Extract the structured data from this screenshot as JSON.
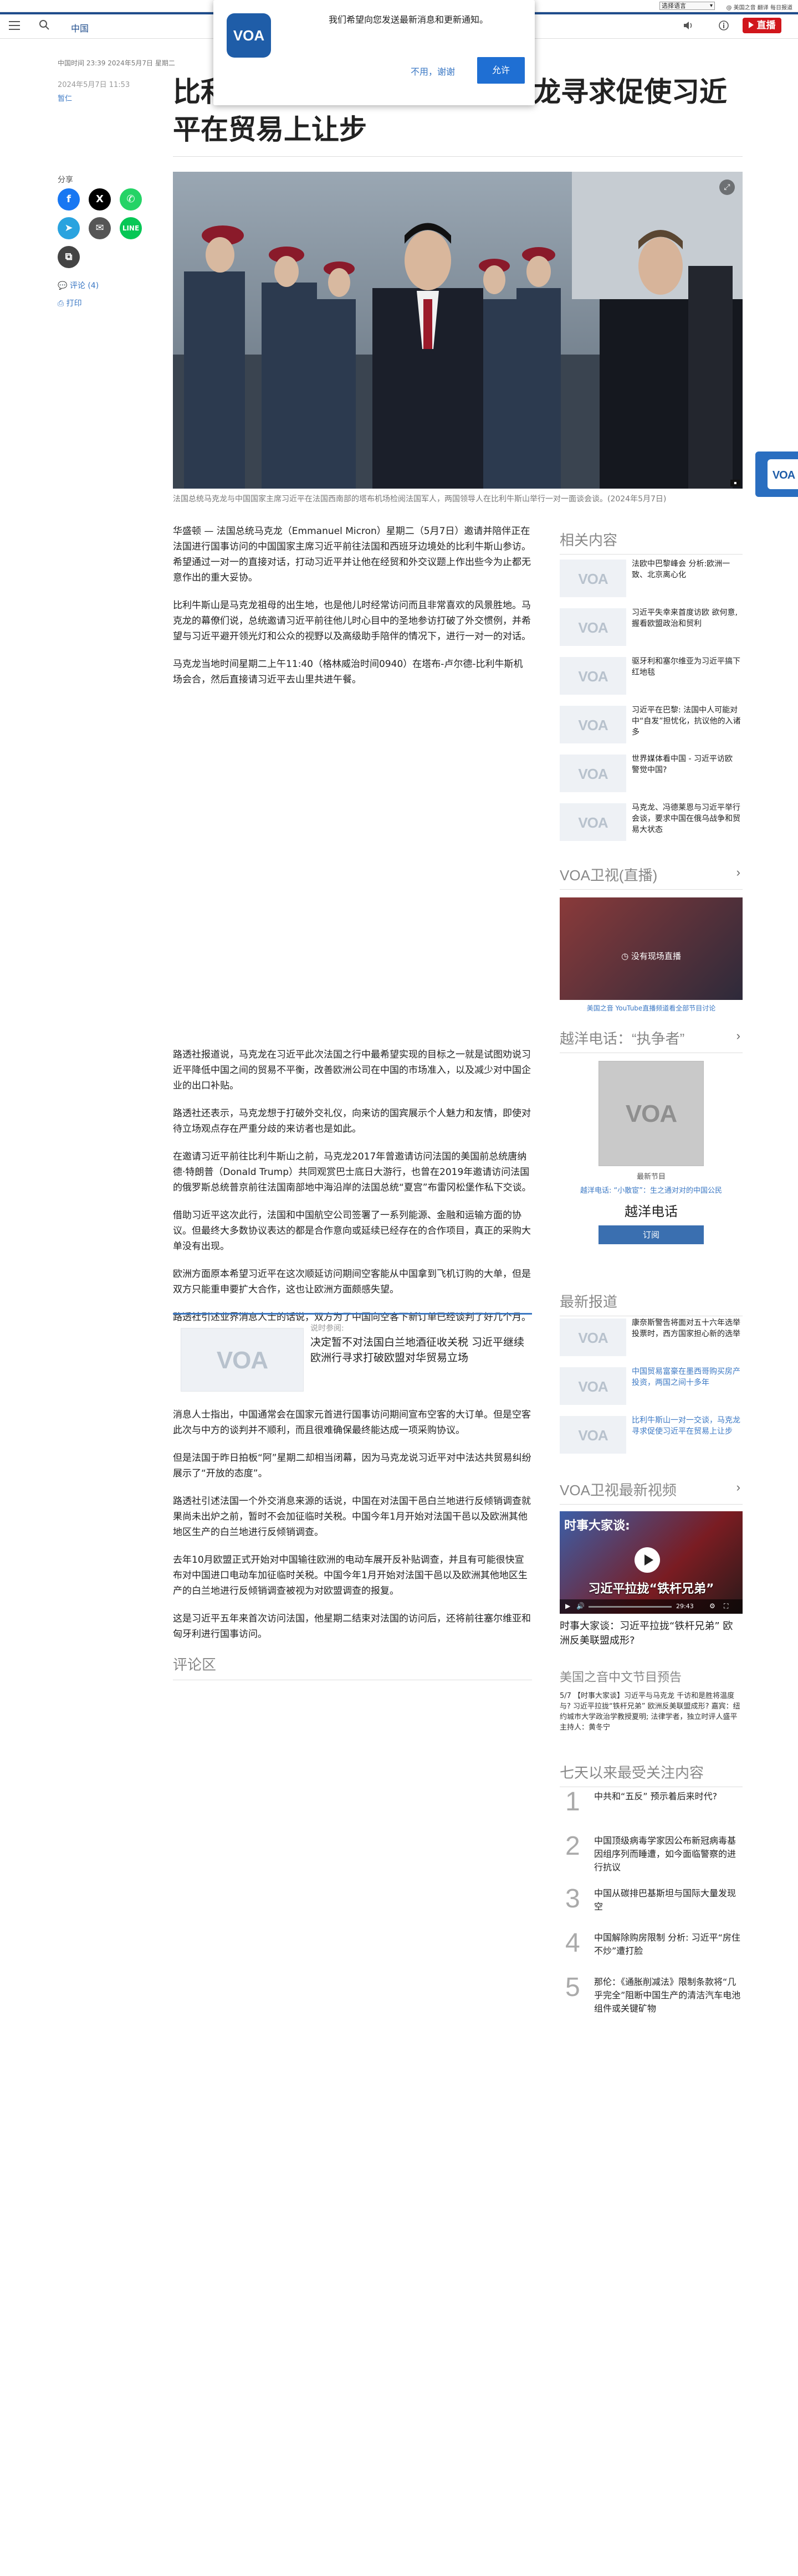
{
  "utility": {
    "language": "选择语言",
    "links": "@ 美国之音 翻译 每日报道"
  },
  "header": {
    "section": "中国",
    "live_label": "直播"
  },
  "notification": {
    "message": "我们希望向您发送最新消息和更新通知。",
    "deny": "不用，谢谢",
    "allow": "允许"
  },
  "article": {
    "dateline": "中国时间 23:39 2024年5月7日 星期二",
    "date": "2024年5月7日 11:53",
    "author": "暂仁",
    "title": "比利牛斯山一对一交谈，马克龙寻求促使习近平在贸易上让步",
    "share_label": "分享",
    "comments_link": "评论 (4)",
    "print_link": "打印",
    "caption": "法国总统马克龙与中国国家主席习近平在法国西南部的塔布机场检阅法国军人，两国领导人在比利牛斯山举行一对一面谈会谈。(2024年5月7日)",
    "paragraphs": [
      "华盛顿 — 法国总统马克龙（Emmanuel Micron）星期二（5月7日）邀请并陪伴正在法国进行国事访问的中国国家主席习近平前往法国和西班牙边境处的比利牛斯山参访。希望通过一对一的直接对话，打动习近平并让他在经贸和外交议题上作出些今为止都无意作出的重大妥协。",
      "比利牛斯山是马克龙祖母的出生地，也是他儿时经常访问而且非常喜欢的风景胜地。马克龙的幕僚们说，总统邀请习近平前往他儿时心目中的圣地参访打破了外交惯例，并希望与习近平避开领光灯和公众的视野以及高级助手陪伴的情况下，进行一对一的对话。",
      "马克龙当地时间星期二上午11:40（格林威治时间0940）在塔布-卢尔德-比利牛斯机场会合，然后直接请习近平去山里共进午餐。",
      "路透社报道说，马克龙在习近平此次法国之行中最希望实现的目标之一就是试图劝说习近平降低中国之间的贸易不平衡，改善欧洲公司在中国的市场准入，以及减少对中国企业的出口补贴。",
      "路透社还表示，马克龙想于打破外交礼仪，向来访的国宾展示个人魅力和友情，即使对待立场观点存在严重分歧的来访者也是如此。",
      "在邀请习近平前往比利牛斯山之前，马克龙2017年曾邀请访问法国的美国前总统唐纳德·特朗普（Donald Trump）共同观赏巴士底日大游行，也曾在2019年邀请访问法国的俄罗斯总统普京前往法国南部地中海沿岸的法国总统“夏宫”布雷冈松堡作私下交谈。",
      "借助习近平这次此行，法国和中国航空公司签署了一系列能源、金融和运输方面的协议。但最终大多数协议表达的都是合作意向或延续已经存在的合作项目，真正的采购大单没有出现。",
      "欧洲方面原本希望习近平在这次顺延访问期间空客能从中国拿到飞机订购的大单，但是双方只能重申要扩大合作，这也让欧洲方面颇感失望。",
      "路透社引述业界消息人士的话说，双方为了中国向空客下新订单已经谈判了好几个月。",
      "消息人士指出，中国通常会在国家元首进行国事访问期间宣布空客的大订单。但是空客此次与中方的谈判并不顺利，而且很难确保最终能达成一项采购协议。",
      "但是法国于昨日拍板“阿”星期二却相当闭幕，因为马克龙说习近平对中法达共贸易纠纷展示了“开放的态度”。",
      "路透社引述法国一个外交消息来源的话说，中国在对法国干邑白兰地进行反倾销调查就果尚未出炉之前，暂时不会加征临时关税。中国今年1月开始对法国干邑以及欧洲其他地区生产的白兰地进行反倾销调查。",
      "去年10月欧盟正式开始对中国输往欧洲的电动车展开反补贴调查，并且有可能很快宣布对中国进口电动车加征临时关税。中国今年1月开始对法国干邑以及欧洲其他地区生产的白兰地进行反倾销调查被视为对欧盟调查的报复。",
      "这是习近平五年来首次访问法国，他星期二结束对法国的访问后，还将前往塞尔维亚和匈牙利进行国事访问。"
    ],
    "related_label": "说时参阅:",
    "related_title": "决定暂不对法国白兰地酒征收关税 习近平继续欧洲行寻求打破欧盟对华贸易立场"
  },
  "comments_heading": "评论区",
  "sidebar": {
    "related_heading": "相关内容",
    "related": [
      "法欧中巴黎峰会 分析:欧洲一致、北京离心化",
      "习近平失幸来首度访欧 欲何意,握看欧盟政治和贸利",
      "驱牙利和塞尔维亚为习近平搞下红地毯",
      "习近平在巴黎: 法国中人可能对中“自发”担忧化，抗议他的入诸多",
      "世界媒体看中国 - 习近平访欧 警觉中国?",
      "马克龙、冯德莱恩与习近平举行会谈，要求中国在俄乌战争和贸易大状态"
    ],
    "tv_heading": "VOA卫视(直播)",
    "tv_overlay": "没有现场直播",
    "tv_link": "美国之音 YouTube直播频道看全部节目讨论",
    "hotline_heading": "越洋电话：“执争者”",
    "hotline_label": "最新节目",
    "hotline_sub": "越洋电话: “小散宦”：生之通对对的中国公民",
    "hotline_title": "越洋电话",
    "subscribe": "订阅",
    "latest_heading": "最新报道",
    "latest": [
      "康奈斯警告将面对五十六年选举投票时，西方国家担心新的选举",
      "中国贸易富豪在墨西哥购买房产投资，两国之间十多年",
      "比利牛斯山一对一交谈，马克龙寻求促使习近平在贸易上让步"
    ],
    "video_heading": "VOA卫视最新视频",
    "video_banner": "时事大家谈:",
    "video_overlay": "习近平拉拢“铁杆兄弟”",
    "video_time": "29:43",
    "video_title": "时事大家谈：习近平拉拢“铁杆兄弟” 欧洲反美联盟成形?",
    "schedule_heading": "美国之音中文节目预告",
    "schedule_text": "5/7 【时事大家谈】习近平与马克龙 千访和是胜将温度与? 习近平拉拢“铁杆兄弟” 欧洲反美联盟成形? 嘉宾：纽约城市大学政治学教授夏明; 法律学者，独立时评人盛平 主持人：黄冬宁",
    "popular_heading": "七天以来最受关注内容",
    "popular": [
      "中共和“五反” 预示着后来时代?",
      "中国顶级病毒学家因公布新冠病毒基因组序列而睡遭，如今面临警察的进行抗议",
      "中国从碳排巴基斯坦与国际大量发现空",
      "中国解除购房限制 分析: 习近平“房住不炒”遭打脸",
      "那伦：《通胀削减法》限制条款将“几乎完全”阻断中国生产的清洁汽车电池组件或关键矿物"
    ]
  },
  "colors": {
    "brand_blue": "#1f4d8c",
    "live_red": "#d1161c",
    "link_blue": "#3b78c4"
  }
}
